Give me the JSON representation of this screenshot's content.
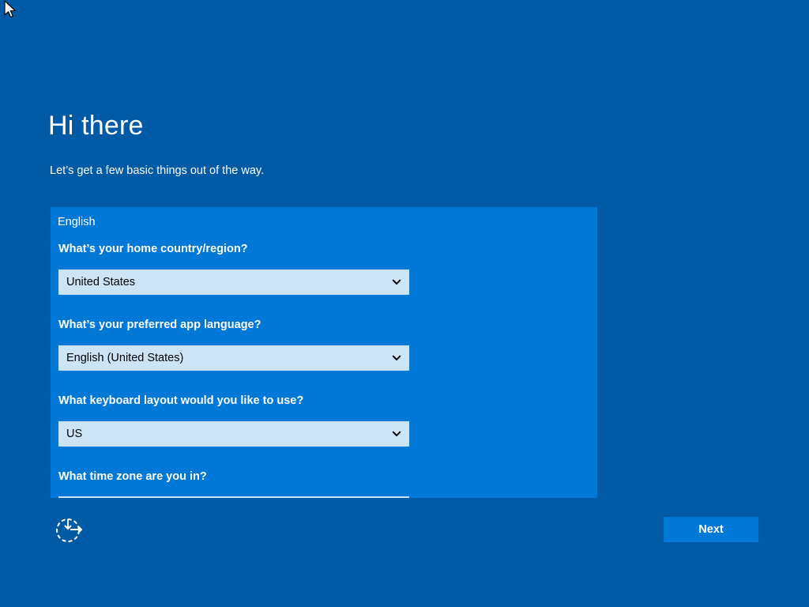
{
  "page": {
    "title": "Hi there",
    "subtitle": "Let’s get a few basic things out of the way."
  },
  "panel": {
    "language_label": "English",
    "fields": [
      {
        "question": "What’s your home country/region?",
        "value": "United States"
      },
      {
        "question": "What’s your preferred app language?",
        "value": "English (United States)"
      },
      {
        "question": "What keyboard layout would you like to use?",
        "value": "US"
      },
      {
        "question": "What time zone are you in?",
        "value": ""
      }
    ]
  },
  "footer": {
    "ease_of_access_icon": "ease-of-access-icon",
    "next_label": "Next"
  },
  "colors": {
    "background": "#005aa6",
    "panel": "#0078d7",
    "select_fill": "#cce4f7",
    "text": "#ffffff"
  }
}
